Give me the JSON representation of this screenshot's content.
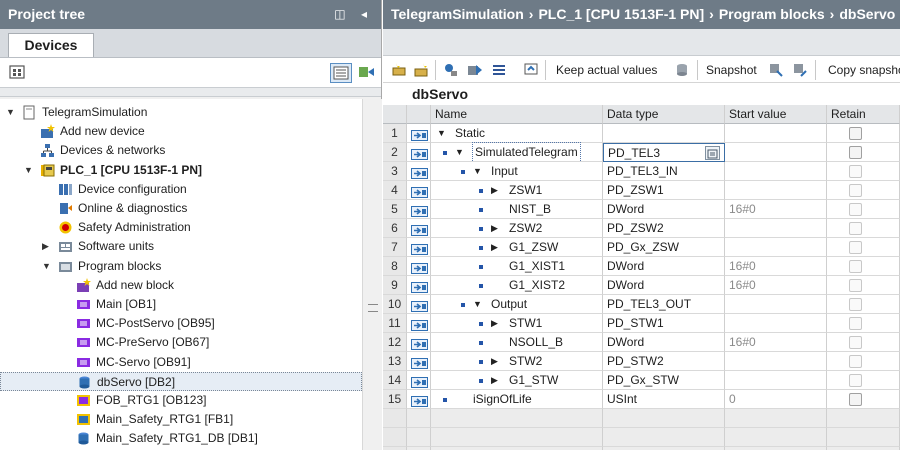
{
  "project_tree": {
    "title": "Project tree",
    "controls": "◫ ◂",
    "tab": "Devices",
    "items": [
      {
        "label": "TelegramSimulation",
        "indent": 0,
        "expander": "▼",
        "icon": "project-icon"
      },
      {
        "label": "Add new device",
        "indent": 1,
        "expander": "",
        "icon": "add-device-icon"
      },
      {
        "label": "Devices & networks",
        "indent": 1,
        "expander": "",
        "icon": "network-icon"
      },
      {
        "label": "PLC_1 [CPU 1513F-1 PN]",
        "indent": 1,
        "expander": "▼",
        "icon": "plc-icon",
        "bold": true
      },
      {
        "label": "Device configuration",
        "indent": 2,
        "expander": "",
        "icon": "device-config-icon"
      },
      {
        "label": "Online & diagnostics",
        "indent": 2,
        "expander": "",
        "icon": "diagnostics-icon"
      },
      {
        "label": "Safety Administration",
        "indent": 2,
        "expander": "",
        "icon": "safety-icon"
      },
      {
        "label": "Software units",
        "indent": 2,
        "expander": "▶",
        "icon": "software-units-icon"
      },
      {
        "label": "Program blocks",
        "indent": 2,
        "expander": "▼",
        "icon": "folder-icon"
      },
      {
        "label": "Add new block",
        "indent": 3,
        "expander": "",
        "icon": "add-block-icon"
      },
      {
        "label": "Main [OB1]",
        "indent": 3,
        "expander": "",
        "icon": "ob-icon"
      },
      {
        "label": "MC-PostServo [OB95]",
        "indent": 3,
        "expander": "",
        "icon": "ob-icon"
      },
      {
        "label": "MC-PreServo [OB67]",
        "indent": 3,
        "expander": "",
        "icon": "ob-icon"
      },
      {
        "label": "MC-Servo [OB91]",
        "indent": 3,
        "expander": "",
        "icon": "ob-icon"
      },
      {
        "label": "dbServo [DB2]",
        "indent": 3,
        "expander": "",
        "icon": "db-icon",
        "selected": true
      },
      {
        "label": "FOB_RTG1 [OB123]",
        "indent": 3,
        "expander": "",
        "icon": "fob-icon"
      },
      {
        "label": "Main_Safety_RTG1 [FB1]",
        "indent": 3,
        "expander": "",
        "icon": "fb-icon"
      },
      {
        "label": "Main_Safety_RTG1_DB [DB1]",
        "indent": 3,
        "expander": "",
        "icon": "db-icon"
      }
    ]
  },
  "breadcrumb": {
    "parts": [
      "TelegramSimulation",
      "PLC_1 [CPU 1513F-1 PN]",
      "Program blocks",
      "dbServo"
    ],
    "separator": "›"
  },
  "editor_toolbar": {
    "keep_actual_values": "Keep actual values",
    "snapshot": "Snapshot",
    "copy_snapshot": "Copy snapsho"
  },
  "block_title": "dbServo",
  "table": {
    "headers": {
      "name": "Name",
      "data_type": "Data type",
      "start_value": "Start value",
      "retain": "Retain"
    },
    "rows": [
      {
        "num": "1",
        "level": 0,
        "expander": "▼",
        "bullet": false,
        "name": "Static",
        "type": "",
        "start": "",
        "retain": true
      },
      {
        "num": "2",
        "level": 1,
        "expander": "▼",
        "bullet": true,
        "name": "SimulatedTelegram",
        "type": "PD_TEL3",
        "start": "",
        "retain": true,
        "active": true
      },
      {
        "num": "3",
        "level": 2,
        "expander": "▼",
        "bullet": true,
        "name": "Input",
        "type": "PD_TEL3_IN",
        "start": "",
        "retain": false
      },
      {
        "num": "4",
        "level": 3,
        "expander": "▶",
        "bullet": true,
        "name": "ZSW1",
        "type": "PD_ZSW1",
        "start": "",
        "retain": false
      },
      {
        "num": "5",
        "level": 3,
        "expander": "",
        "bullet": true,
        "name": "NIST_B",
        "type": "DWord",
        "start": "16#0",
        "retain": false
      },
      {
        "num": "6",
        "level": 3,
        "expander": "▶",
        "bullet": true,
        "name": "ZSW2",
        "type": "PD_ZSW2",
        "start": "",
        "retain": false
      },
      {
        "num": "7",
        "level": 3,
        "expander": "▶",
        "bullet": true,
        "name": "G1_ZSW",
        "type": "PD_Gx_ZSW",
        "start": "",
        "retain": false
      },
      {
        "num": "8",
        "level": 3,
        "expander": "",
        "bullet": true,
        "name": "G1_XIST1",
        "type": "DWord",
        "start": "16#0",
        "retain": false
      },
      {
        "num": "9",
        "level": 3,
        "expander": "",
        "bullet": true,
        "name": "G1_XIST2",
        "type": "DWord",
        "start": "16#0",
        "retain": false
      },
      {
        "num": "10",
        "level": 2,
        "expander": "▼",
        "bullet": true,
        "name": "Output",
        "type": "PD_TEL3_OUT",
        "start": "",
        "retain": false
      },
      {
        "num": "11",
        "level": 3,
        "expander": "▶",
        "bullet": true,
        "name": "STW1",
        "type": "PD_STW1",
        "start": "",
        "retain": false
      },
      {
        "num": "12",
        "level": 3,
        "expander": "",
        "bullet": true,
        "name": "NSOLL_B",
        "type": "DWord",
        "start": "16#0",
        "retain": false
      },
      {
        "num": "13",
        "level": 3,
        "expander": "▶",
        "bullet": true,
        "name": "STW2",
        "type": "PD_STW2",
        "start": "",
        "retain": false
      },
      {
        "num": "14",
        "level": 3,
        "expander": "▶",
        "bullet": true,
        "name": "G1_STW",
        "type": "PD_Gx_STW",
        "start": "",
        "retain": false
      },
      {
        "num": "15",
        "level": 1,
        "expander": "",
        "bullet": true,
        "name": "iSignOfLife",
        "type": "USInt",
        "start": "0",
        "retain": true
      }
    ]
  },
  "colors": {
    "title_bar": "#6e7b87",
    "selection": "#e6edf5",
    "accent": "#2455a8"
  }
}
